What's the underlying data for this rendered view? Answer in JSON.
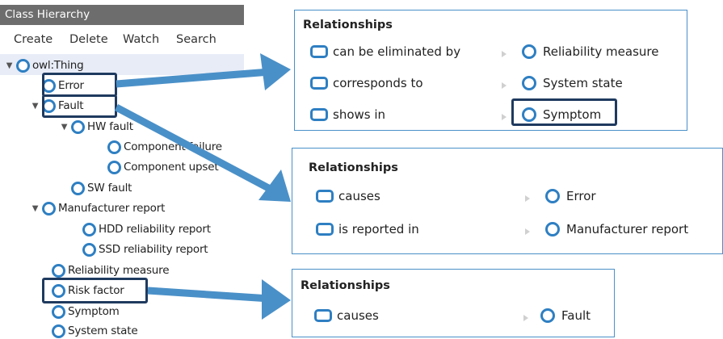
{
  "hierarchy": {
    "title": "Class Hierarchy",
    "menu": [
      "Create",
      "Delete",
      "Watch",
      "Search"
    ],
    "nodes": [
      {
        "label": "owl:Thing",
        "toggle": "expanded"
      },
      {
        "label": "Error",
        "toggle": "none"
      },
      {
        "label": "Fault",
        "toggle": "expanded"
      },
      {
        "label": "HW fault",
        "toggle": "expanded"
      },
      {
        "label": "Component failure",
        "toggle": "none"
      },
      {
        "label": "Component upset",
        "toggle": "none"
      },
      {
        "label": "SW fault",
        "toggle": "none"
      },
      {
        "label": "Manufacturer report",
        "toggle": "expanded"
      },
      {
        "label": "HDD reliability report",
        "toggle": "none"
      },
      {
        "label": "SSD reliability report",
        "toggle": "none"
      },
      {
        "label": "Reliability measure",
        "toggle": "none"
      },
      {
        "label": "Risk factor",
        "toggle": "none"
      },
      {
        "label": "Symptom",
        "toggle": "none"
      },
      {
        "label": "System state",
        "toggle": "none"
      }
    ],
    "highlighted": [
      "Error",
      "Fault",
      "Risk factor"
    ]
  },
  "panels": [
    {
      "title": "Relationships",
      "rows": [
        {
          "property": "can be eliminated by",
          "target": "Reliability measure"
        },
        {
          "property": "corresponds to",
          "target": "System state"
        },
        {
          "property": "shows in",
          "target": "Symptom",
          "highlighted": true
        }
      ]
    },
    {
      "title": "Relationships",
      "rows": [
        {
          "property": "causes",
          "target": "Error"
        },
        {
          "property": "is reported in",
          "target": "Manufacturer report"
        }
      ]
    },
    {
      "title": "Relationships",
      "rows": [
        {
          "property": "causes",
          "target": "Fault"
        }
      ]
    }
  ],
  "colors": {
    "arrow": "#4a90c8",
    "highlight_border": "#1f3a5f",
    "class_icon": "#2e7fc2",
    "panel_border": "#4a90c8",
    "header_bg": "#6d6d6d",
    "root_band": "#e8ecf7"
  },
  "icons": {
    "class": "class-circle-icon",
    "property": "object-property-icon",
    "expanded": "triangle-down-icon"
  }
}
